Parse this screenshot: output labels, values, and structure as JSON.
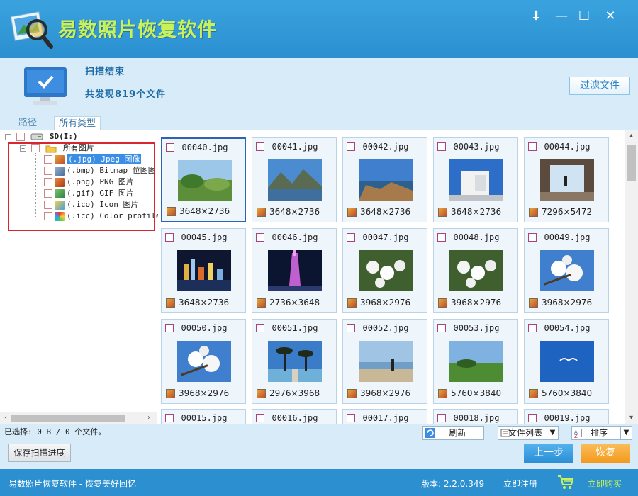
{
  "app": {
    "title": "易数照片恢复软件",
    "window_controls": [
      "⬇",
      "—",
      "☐",
      "✕"
    ]
  },
  "status": {
    "title": "扫描结束",
    "summary": "共发现819个文件",
    "filter_button": "过滤文件"
  },
  "tabs": [
    {
      "label": "路径",
      "active": false
    },
    {
      "label": "所有类型",
      "active": true
    }
  ],
  "tree": {
    "drive": "SD(I:)",
    "root": "所有图片",
    "items": [
      {
        "label": "(.jpg) Jpeg 图像",
        "icon": "jpeg-icon",
        "selected": true
      },
      {
        "label": "(.bmp) Bitmap 位图图",
        "icon": "bitmap-icon",
        "selected": false
      },
      {
        "label": "(.png) PNG 图片",
        "icon": "png-icon",
        "selected": false
      },
      {
        "label": "(.gif) GIF 图片",
        "icon": "gif-icon",
        "selected": false
      },
      {
        "label": "(.ico) Icon 图片",
        "icon": "ico-icon",
        "selected": false
      },
      {
        "label": "(.icc) Color profile",
        "icon": "icc-icon",
        "selected": false
      }
    ]
  },
  "files": [
    {
      "name": "00040.jpg",
      "dims": "3648×2736",
      "thumb": "landscape-park"
    },
    {
      "name": "00041.jpg",
      "dims": "3648×2736",
      "thumb": "mountain-lake"
    },
    {
      "name": "00042.jpg",
      "dims": "3648×2736",
      "thumb": "rocky-shore"
    },
    {
      "name": "00043.jpg",
      "dims": "3648×2736",
      "thumb": "white-building"
    },
    {
      "name": "00044.jpg",
      "dims": "7296×5472",
      "thumb": "window-person"
    },
    {
      "name": "00045.jpg",
      "dims": "3648×2736",
      "thumb": "city-night"
    },
    {
      "name": "00046.jpg",
      "dims": "2736×3648",
      "thumb": "canton-tower"
    },
    {
      "name": "00047.jpg",
      "dims": "3968×2976",
      "thumb": "white-blossoms"
    },
    {
      "name": "00048.jpg",
      "dims": "3968×2976",
      "thumb": "white-blossoms"
    },
    {
      "name": "00049.jpg",
      "dims": "3968×2976",
      "thumb": "white-blossoms-sky"
    },
    {
      "name": "00050.jpg",
      "dims": "3968×2976",
      "thumb": "white-blossoms-sky"
    },
    {
      "name": "00051.jpg",
      "dims": "2976×3968",
      "thumb": "palm-pier"
    },
    {
      "name": "00052.jpg",
      "dims": "3968×2976",
      "thumb": "beach-person"
    },
    {
      "name": "00053.jpg",
      "dims": "5760×3840",
      "thumb": "green-field"
    },
    {
      "name": "00054.jpg",
      "dims": "5760×3840",
      "thumb": "seagull-sky"
    },
    {
      "name": "00015.jpg",
      "dims": "",
      "thumb": ""
    },
    {
      "name": "00016.jpg",
      "dims": "",
      "thumb": ""
    },
    {
      "name": "00017.jpg",
      "dims": "",
      "thumb": ""
    },
    {
      "name": "00018.jpg",
      "dims": "",
      "thumb": ""
    },
    {
      "name": "00019.jpg",
      "dims": "",
      "thumb": ""
    }
  ],
  "toolbar": {
    "selection_info": "已选择: 0 B / 0 个文件。",
    "refresh": "刷新",
    "view": "文件列表",
    "sort": "排序"
  },
  "actions": {
    "save_scan": "保存扫描进度",
    "prev": "上一步",
    "recover": "恢复"
  },
  "footer": {
    "slogan": "易数照片恢复软件 - 恢复美好回忆",
    "version": "版本: 2.2.0.349",
    "register": "立即注册",
    "buy": "立即购买"
  },
  "colors": {
    "titlebar": "#2b8fd0",
    "header": "#d7ecf8",
    "accent_green": "#c9f25a",
    "recover_orange": "#f39a1c",
    "prev_blue": "#2a8fd7"
  }
}
